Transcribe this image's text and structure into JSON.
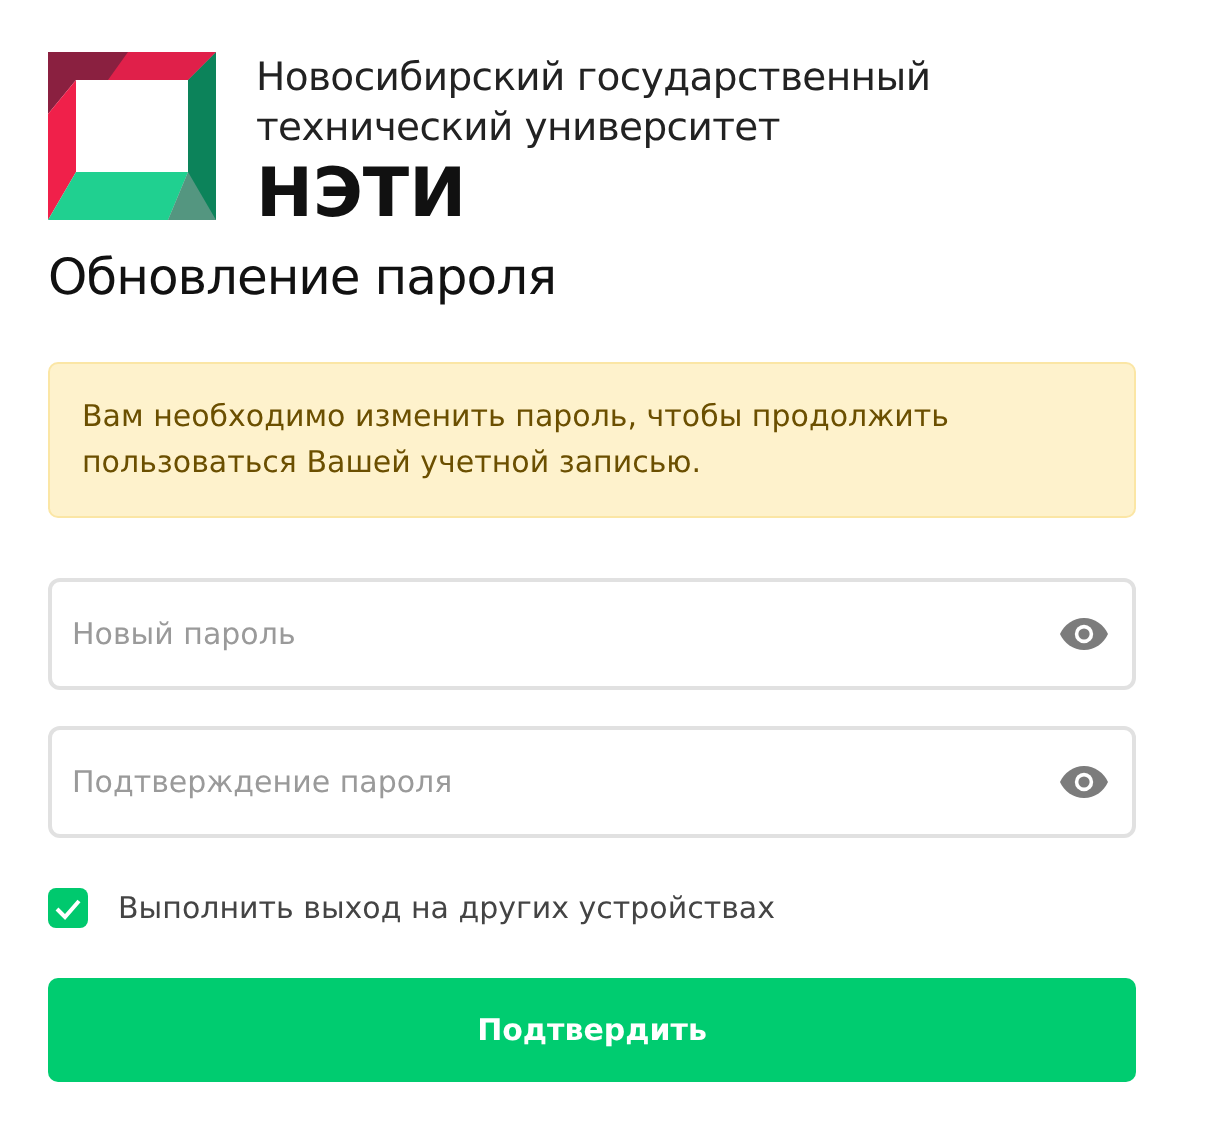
{
  "header": {
    "university_name": "Новосибирский государственный технический университет",
    "abbreviation": "НЭТИ"
  },
  "title": "Обновление пароля",
  "alert": {
    "message": "Вам необходимо изменить пароль, чтобы продолжить пользоваться Вашей учетной записью."
  },
  "fields": [
    {
      "placeholder": "Новый пароль"
    },
    {
      "placeholder": "Подтверждение пароля"
    }
  ],
  "logout_other_devices": {
    "label": "Выполнить выход на других устройствах",
    "checked": true
  },
  "submit_button": "Подтвердить"
}
